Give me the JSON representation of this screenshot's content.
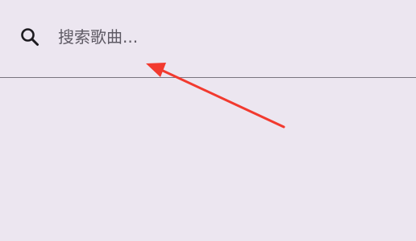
{
  "search": {
    "placeholder": "搜索歌曲...",
    "value": "",
    "icon": "search-icon"
  },
  "colors": {
    "background": "#ece6f0",
    "divider": "#79747e",
    "placeholder_text": "#5e5a64",
    "annotation_arrow": "#f23a2f"
  }
}
